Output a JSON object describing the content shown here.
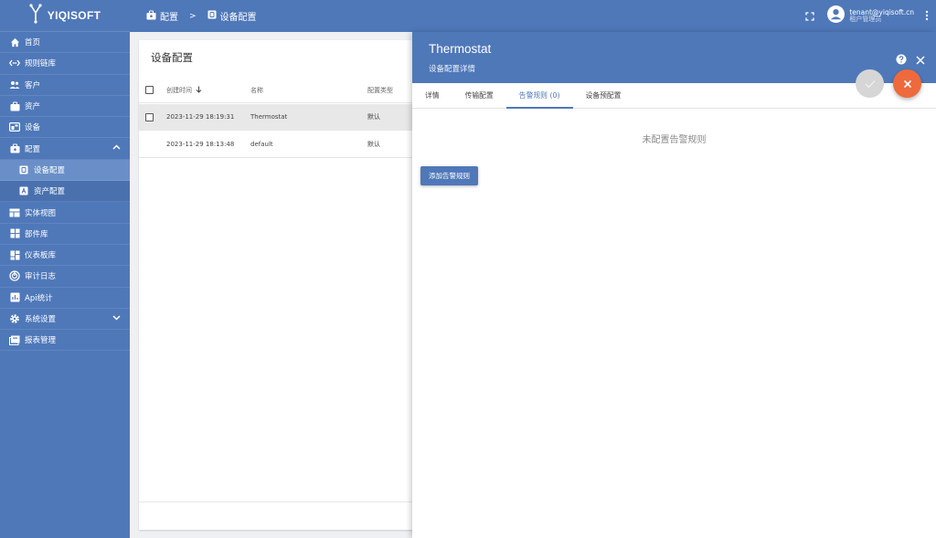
{
  "app": {
    "name": "YIQISOFT"
  },
  "breadcrumb": [
    {
      "label": "配置",
      "icon": "config-icon"
    },
    {
      "label": "设备配置",
      "icon": "device-profile-icon"
    }
  ],
  "breadcrumb_separator": ">",
  "user": {
    "email": "tenant@yiqisoft.cn",
    "role": "租户管理员"
  },
  "sidebar": {
    "items": [
      {
        "label": "首页",
        "icon": "home-icon"
      },
      {
        "label": "规则链库",
        "icon": "rule-chain-icon"
      },
      {
        "label": "客户",
        "icon": "customers-icon"
      },
      {
        "label": "资产",
        "icon": "assets-icon"
      },
      {
        "label": "设备",
        "icon": "devices-icon"
      },
      {
        "label": "配置",
        "icon": "config-icon",
        "expanded": true
      },
      {
        "label": "设备配置",
        "icon": "device-profile-icon",
        "sub": true,
        "active": true
      },
      {
        "label": "资产配置",
        "icon": "asset-profile-icon",
        "sub": true
      },
      {
        "label": "实体视图",
        "icon": "entity-view-icon"
      },
      {
        "label": "部件库",
        "icon": "widgets-icon"
      },
      {
        "label": "仪表板库",
        "icon": "dashboard-icon"
      },
      {
        "label": "审计日志",
        "icon": "audit-log-icon"
      },
      {
        "label": "Api统计",
        "icon": "api-usage-icon"
      },
      {
        "label": "系统设置",
        "icon": "settings-icon"
      },
      {
        "label": "报表管理",
        "icon": "reports-icon"
      }
    ]
  },
  "list": {
    "title": "设备配置",
    "columns": [
      "创建时间",
      "名称",
      "配置类型"
    ],
    "rows": [
      {
        "created": "2023-11-29 18:19:31",
        "name": "Thermostat",
        "type": "默认",
        "selected": true
      },
      {
        "created": "2023-11-29 18:13:48",
        "name": "default",
        "type": "默认",
        "selected": false
      }
    ]
  },
  "detail": {
    "title": "Thermostat",
    "subtitle": "设备配置详情",
    "tabs": [
      "详情",
      "传输配置",
      "告警规则 (0)",
      "设备预配置"
    ],
    "active_tab": 2,
    "empty_message": "未配置告警规则",
    "add_button": "添加告警规则"
  },
  "colors": {
    "primary": "#4f78b9",
    "accent": "#ee6a3c"
  }
}
